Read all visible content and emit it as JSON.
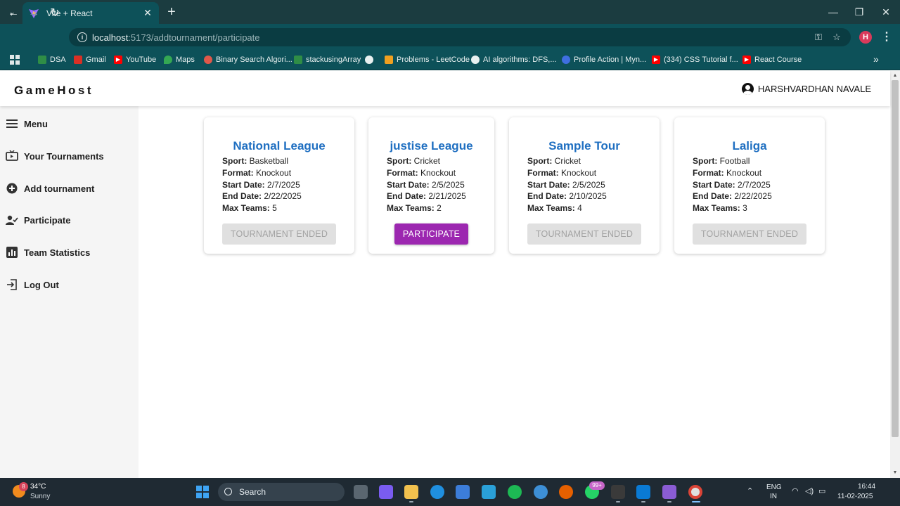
{
  "browser": {
    "tab_title": "Vite + React",
    "url_host": "localhost",
    "url_path": ":5173/addtournament/participate",
    "profile_initial": "H",
    "bookmarks": [
      {
        "label": "DSA",
        "icon": "gfg-icon",
        "color": "#2f8d46"
      },
      {
        "label": "Gmail",
        "icon": "gmail-icon",
        "color": "#d93025"
      },
      {
        "label": "YouTube",
        "icon": "youtube-icon",
        "color": "#ff0000"
      },
      {
        "label": "Maps",
        "icon": "maps-icon",
        "color": "#34a853"
      },
      {
        "label": "Binary Search Algori...",
        "icon": "pin-icon",
        "color": "#e0584a"
      },
      {
        "label": "stackusingArray",
        "icon": "gfg-icon",
        "color": "#2f8d46"
      },
      {
        "label": "",
        "icon": "globe-icon",
        "color": "#e8f0f0"
      },
      {
        "label": "Problems - LeetCode",
        "icon": "leetcode-icon",
        "color": "#f0a020"
      },
      {
        "label": "AI algorithms: DFS,...",
        "icon": "openai-icon",
        "color": "#e8f0f0"
      },
      {
        "label": "Profile Action | Myn...",
        "icon": "myntra-icon",
        "color": "#3f6fe0"
      },
      {
        "label": "(334) CSS Tutorial f...",
        "icon": "youtube-icon",
        "color": "#ff0000"
      },
      {
        "label": "React Course",
        "icon": "youtube-icon",
        "color": "#ff0000"
      }
    ]
  },
  "app": {
    "brand": "GameHost",
    "user_name": "HARSHVARDHAN NAVALE",
    "sidebar": [
      {
        "label": "Menu",
        "icon": "menu-icon"
      },
      {
        "label": "Your Tournaments",
        "icon": "tv-icon"
      },
      {
        "label": "Add tournament",
        "icon": "add-circle-icon"
      },
      {
        "label": "Participate",
        "icon": "person-check-icon"
      },
      {
        "label": "Team Statistics",
        "icon": "bar-chart-icon"
      },
      {
        "label": "Log Out",
        "icon": "logout-icon"
      }
    ],
    "field_labels": {
      "sport": "Sport:",
      "format": "Format:",
      "start": "Start Date:",
      "end": "End Date:",
      "max": "Max Teams:"
    },
    "tournaments": [
      {
        "name": "National League",
        "sport": "Basketball",
        "format": "Knockout",
        "start_date": "2/7/2025",
        "end_date": "2/22/2025",
        "max_teams": "5",
        "action": "TOURNAMENT ENDED"
      },
      {
        "name": "justise League",
        "sport": "Cricket",
        "format": "Knockout",
        "start_date": "2/5/2025",
        "end_date": "2/21/2025",
        "max_teams": "2",
        "action": "PARTICIPATE"
      },
      {
        "name": "Sample Tour",
        "sport": "Cricket",
        "format": "Knockout",
        "start_date": "2/5/2025",
        "end_date": "2/10/2025",
        "max_teams": "4",
        "action": "TOURNAMENT ENDED"
      },
      {
        "name": "Laliga",
        "sport": "Football",
        "format": "Knockout",
        "start_date": "2/7/2025",
        "end_date": "2/22/2025",
        "max_teams": "3",
        "action": "TOURNAMENT ENDED"
      }
    ],
    "colors": {
      "title": "#1f6fc1",
      "participate": "#9c27b0",
      "ended_bg": "#e0e0e0"
    }
  },
  "taskbar": {
    "weather_temp": "34°C",
    "weather_cond": "Sunny",
    "weather_badge": "8",
    "search_label": "Search",
    "whatsapp_badge": "99+",
    "lang_line1": "ENG",
    "lang_line2": "IN",
    "time": "16:44",
    "date": "11-02-2025"
  }
}
